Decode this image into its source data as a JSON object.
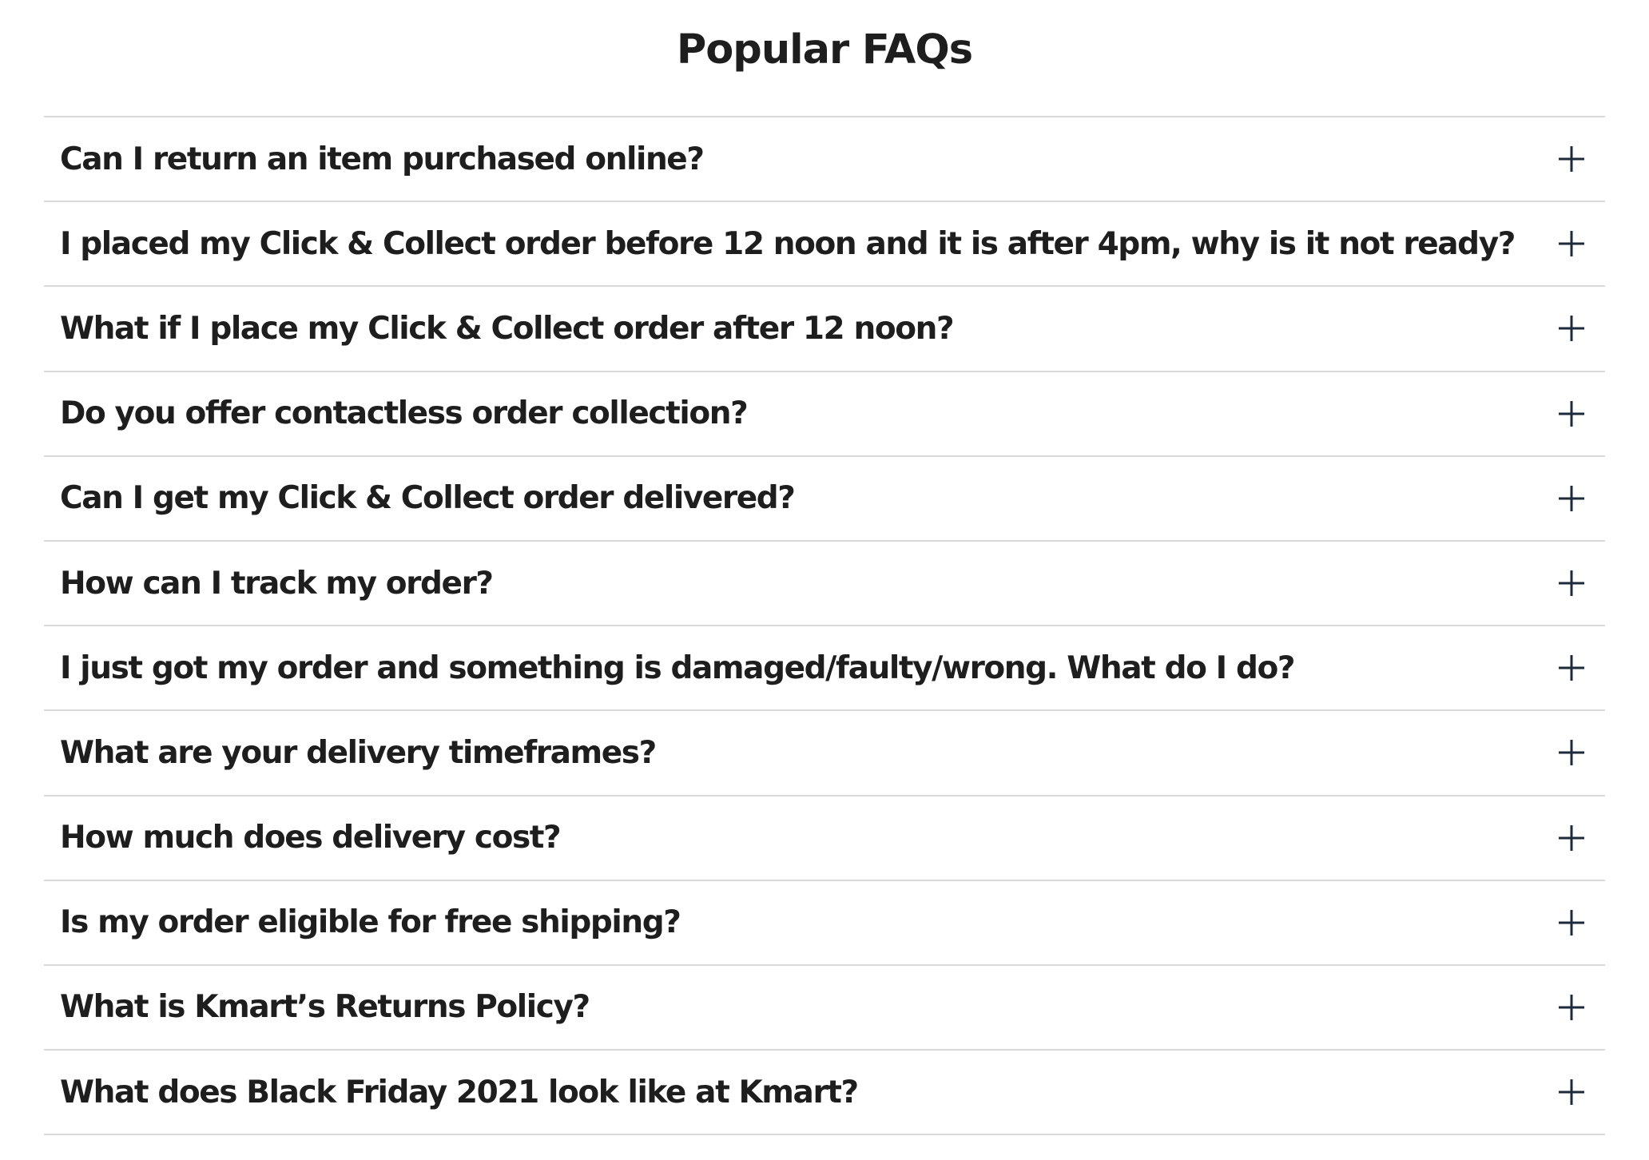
{
  "faq": {
    "title": "Popular FAQs",
    "icon": "plus-icon",
    "icon_color": "#1e2a3a",
    "text_color": "#1e1e1e",
    "divider_color": "#d9d9d9",
    "items": [
      {
        "question": "Can I return an item purchased online?"
      },
      {
        "question": "I placed my Click & Collect order before 12 noon and it is after 4pm, why is it not ready?"
      },
      {
        "question": "What if I place my Click & Collect order after 12 noon?"
      },
      {
        "question": "Do you offer contactless order collection?"
      },
      {
        "question": "Can I get my Click & Collect order delivered?"
      },
      {
        "question": "How can I track my order?"
      },
      {
        "question": "I just got my order and something is damaged/faulty/wrong. What do I do?"
      },
      {
        "question": "What are your delivery timeframes?"
      },
      {
        "question": "How much does delivery cost?"
      },
      {
        "question": "Is my order eligible for free shipping?"
      },
      {
        "question": "What is Kmart’s Returns Policy?"
      },
      {
        "question": "What does Black Friday 2021 look like at Kmart?"
      }
    ]
  }
}
